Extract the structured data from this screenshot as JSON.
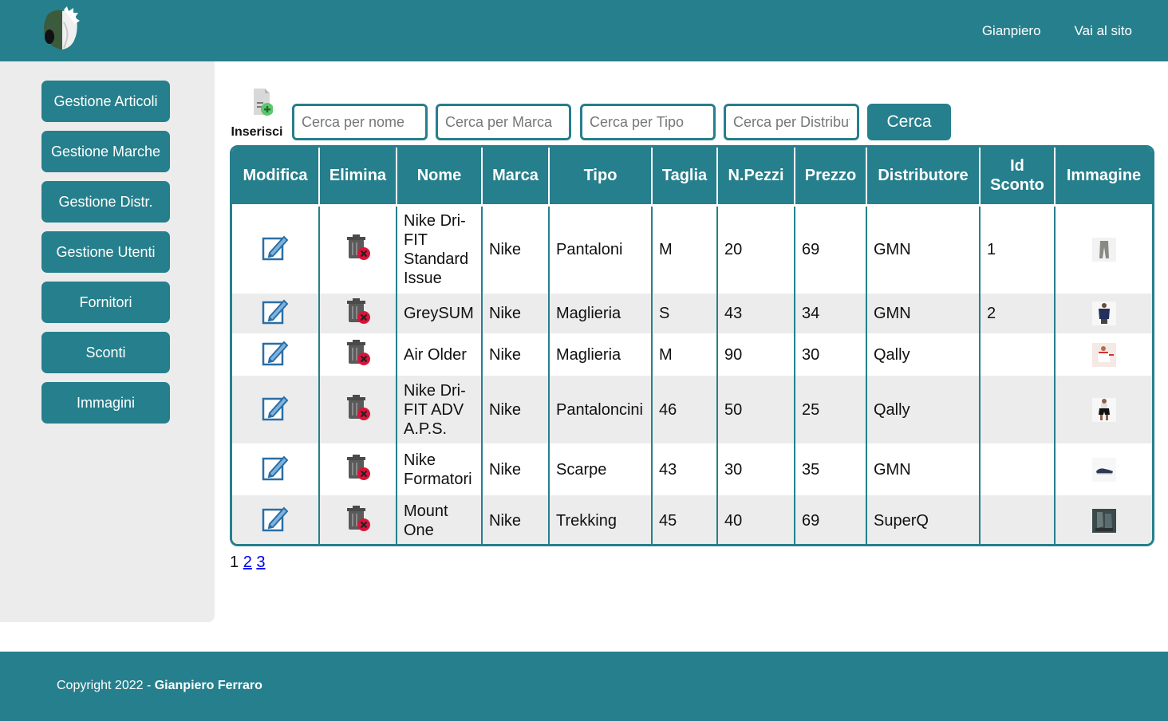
{
  "header": {
    "user_label": "Gianpiero",
    "site_link": "Vai al sito"
  },
  "sidebar": {
    "items": [
      {
        "label": "Gestione Articoli"
      },
      {
        "label": "Gestione Marche"
      },
      {
        "label": "Gestione Distr."
      },
      {
        "label": "Gestione Utenti"
      },
      {
        "label": "Fornitori"
      },
      {
        "label": "Sconti"
      },
      {
        "label": "Immagini"
      }
    ]
  },
  "toolbar": {
    "insert_label": "Inserisci",
    "search_name_placeholder": "Cerca per nome",
    "search_brand_placeholder": "Cerca per Marca",
    "search_type_placeholder": "Cerca per Tipo",
    "search_distributor_placeholder": "Cerca per Distributore",
    "search_button": "Cerca"
  },
  "table": {
    "headers": [
      "Modifica",
      "Elimina",
      "Nome",
      "Marca",
      "Tipo",
      "Taglia",
      "N.Pezzi",
      "Prezzo",
      "Distributore",
      "Id Sconto",
      "Immagine"
    ],
    "rows": [
      {
        "nome": "Nike Dri-FIT Standard Issue",
        "marca": "Nike",
        "tipo": "Pantaloni",
        "taglia": "M",
        "pezzi": "20",
        "prezzo": "69",
        "distributore": "GMN",
        "sconto": "1",
        "thumb": "grey-pants"
      },
      {
        "nome": "GreySUM",
        "marca": "Nike",
        "tipo": "Maglieria",
        "taglia": "S",
        "pezzi": "43",
        "prezzo": "34",
        "distributore": "GMN",
        "sconto": "2",
        "thumb": "navy-shirt"
      },
      {
        "nome": "Air Older",
        "marca": "Nike",
        "tipo": "Maglieria",
        "taglia": "M",
        "pezzi": "90",
        "prezzo": "30",
        "distributore": "Qally",
        "sconto": "",
        "thumb": "white-shirt"
      },
      {
        "nome": "Nike Dri-FIT ADV A.P.S.",
        "marca": "Nike",
        "tipo": "Pantaloncini",
        "taglia": "46",
        "pezzi": "50",
        "prezzo": "25",
        "distributore": "Qally",
        "sconto": "",
        "thumb": "black-shorts"
      },
      {
        "nome": "Nike Formatori",
        "marca": "Nike",
        "tipo": "Scarpe",
        "taglia": "43",
        "pezzi": "30",
        "prezzo": "35",
        "distributore": "GMN",
        "sconto": "",
        "thumb": "shoe"
      },
      {
        "nome": "Mount One",
        "marca": "Nike",
        "tipo": "Trekking",
        "taglia": "45",
        "pezzi": "40",
        "prezzo": "69",
        "distributore": "SuperQ",
        "sconto": "",
        "thumb": "boots"
      }
    ]
  },
  "pagination": {
    "current": "1",
    "page2": "2",
    "page3": "3"
  },
  "footer": {
    "copyright": "Copyright 2022 - ",
    "author": "Gianpiero Ferraro"
  },
  "colors": {
    "accent": "#267f8c",
    "row_alt": "#ececec"
  }
}
